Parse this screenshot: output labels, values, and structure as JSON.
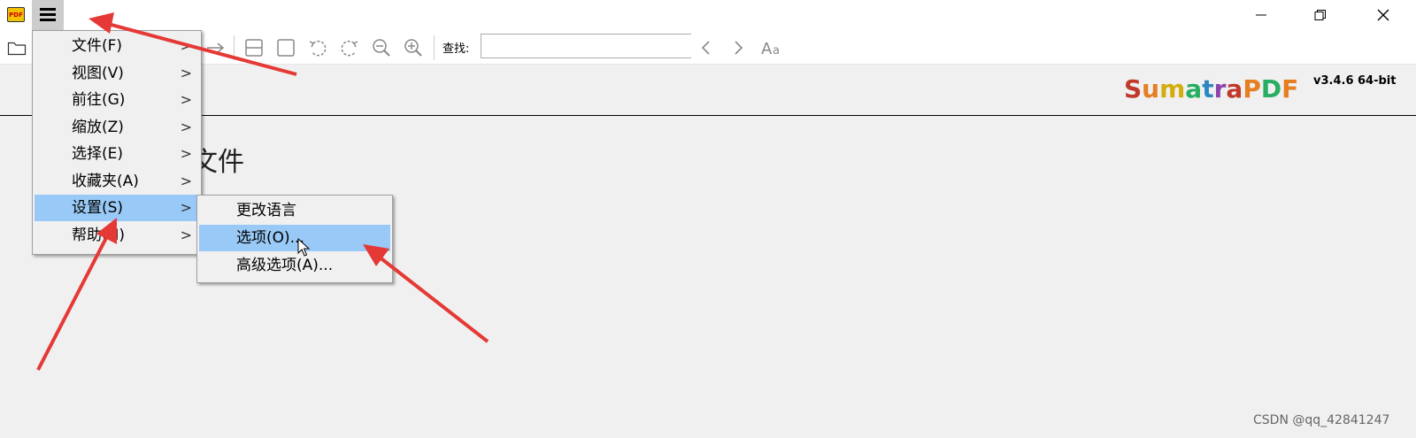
{
  "app": {
    "icon_text": "PDF",
    "logo": [
      {
        "text": "S",
        "color": "#c0392b"
      },
      {
        "text": "u",
        "color": "#e67e22"
      },
      {
        "text": "m",
        "color": "#d4ac0d"
      },
      {
        "text": "a",
        "color": "#27ae60"
      },
      {
        "text": "t",
        "color": "#2e86c1"
      },
      {
        "text": "r",
        "color": "#8e44ad"
      },
      {
        "text": "a",
        "color": "#c0392b"
      },
      {
        "text": "P",
        "color": "#e67e22"
      },
      {
        "text": "D",
        "color": "#27ae60"
      },
      {
        "text": "F",
        "color": "#e67e22"
      }
    ],
    "version": "v3.4.6 64-bit"
  },
  "toolbar": {
    "find_label": "查找:",
    "find_value": "",
    "icons": [
      "folder-icon",
      "arrow-right-icon",
      "fit-page-icon",
      "fit-width-icon",
      "rotate-left-icon",
      "rotate-right-icon",
      "zoom-out-icon",
      "zoom-in-icon",
      "prev-result-icon",
      "next-result-icon",
      "match-case-icon"
    ]
  },
  "content": {
    "partial_text": "文件"
  },
  "main_menu": {
    "items": [
      {
        "label": "文件(F)",
        "arrow": ">"
      },
      {
        "label": "视图(V)",
        "arrow": ">"
      },
      {
        "label": "前往(G)",
        "arrow": ">"
      },
      {
        "label": "缩放(Z)",
        "arrow": ">"
      },
      {
        "label": "选择(E)",
        "arrow": ">"
      },
      {
        "label": "收藏夹(A)",
        "arrow": ">"
      },
      {
        "label": "设置(S)",
        "arrow": ">",
        "highlighted": true
      },
      {
        "label": "帮助(H)",
        "arrow": ">"
      }
    ]
  },
  "settings_submenu": {
    "items": [
      {
        "label": "更改语言"
      },
      {
        "label": "选项(O)...",
        "highlighted": true
      },
      {
        "label": "高级选项(A)..."
      }
    ]
  },
  "watermark": "CSDN @qq_42841247",
  "colors": {
    "highlight": "#99c9f6",
    "annotation_arrow": "#e53935"
  }
}
